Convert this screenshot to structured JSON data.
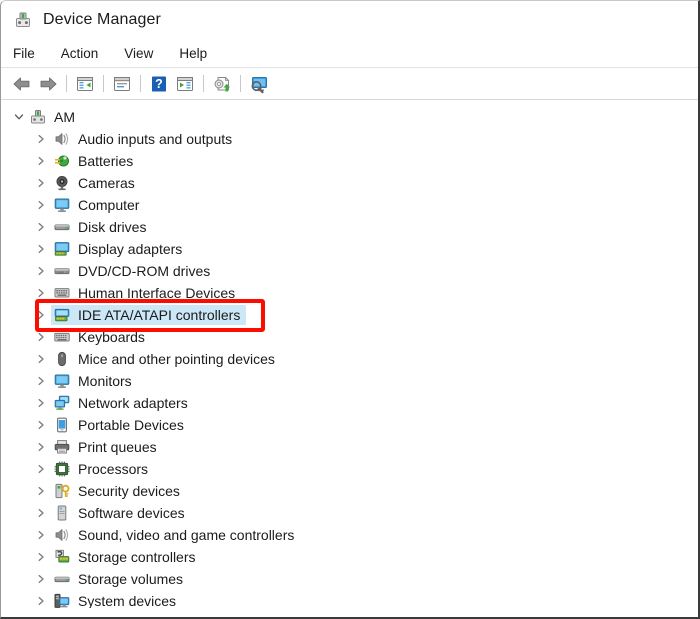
{
  "window": {
    "title": "Device Manager",
    "title_icon": "device-manager-icon"
  },
  "menubar": {
    "items": [
      {
        "label": "File",
        "name": "menu-file"
      },
      {
        "label": "Action",
        "name": "menu-action"
      },
      {
        "label": "View",
        "name": "menu-view"
      },
      {
        "label": "Help",
        "name": "menu-help"
      }
    ]
  },
  "toolbar": {
    "buttons": [
      {
        "name": "back-arrow-icon",
        "title": "Back"
      },
      {
        "name": "forward-arrow-icon",
        "title": "Forward"
      },
      {
        "name": "divider-1",
        "title": ""
      },
      {
        "name": "show-hide-console-tree-icon",
        "title": "Show/Hide Console Tree"
      },
      {
        "name": "properties-icon",
        "title": "Properties"
      },
      {
        "name": "divider-2",
        "title": ""
      },
      {
        "name": "help-icon",
        "title": "Help"
      },
      {
        "name": "scan-for-hardware-changes-icon",
        "title": "Scan for hardware changes"
      },
      {
        "name": "divider-3",
        "title": ""
      },
      {
        "name": "update-driver-icon",
        "title": "Update driver"
      },
      {
        "name": "divider-4",
        "title": ""
      },
      {
        "name": "display-devices-icon",
        "title": "Display devices"
      }
    ]
  },
  "tree": {
    "root": {
      "label": "AM",
      "expanded": true,
      "icon": "computer-root-icon"
    },
    "items": [
      {
        "label": "Audio inputs and outputs",
        "icon": "speaker-icon",
        "selected": false
      },
      {
        "label": "Batteries",
        "icon": "battery-icon",
        "selected": false
      },
      {
        "label": "Cameras",
        "icon": "camera-icon",
        "selected": false
      },
      {
        "label": "Computer",
        "icon": "monitor-icon",
        "selected": false
      },
      {
        "label": "Disk drives",
        "icon": "disk-drive-icon",
        "selected": false
      },
      {
        "label": "Display adapters",
        "icon": "display-adapter-icon",
        "selected": false
      },
      {
        "label": "DVD/CD-ROM drives",
        "icon": "dvd-drive-icon",
        "selected": false
      },
      {
        "label": "Human Interface Devices",
        "icon": "hid-icon",
        "selected": false
      },
      {
        "label": "IDE ATA/ATAPI controllers",
        "icon": "ide-controller-icon",
        "selected": true
      },
      {
        "label": "Keyboards",
        "icon": "keyboard-icon",
        "selected": false
      },
      {
        "label": "Mice and other pointing devices",
        "icon": "mouse-icon",
        "selected": false
      },
      {
        "label": "Monitors",
        "icon": "monitor-icon",
        "selected": false
      },
      {
        "label": "Network adapters",
        "icon": "network-adapter-icon",
        "selected": false
      },
      {
        "label": "Portable Devices",
        "icon": "portable-device-icon",
        "selected": false
      },
      {
        "label": "Print queues",
        "icon": "printer-icon",
        "selected": false
      },
      {
        "label": "Processors",
        "icon": "processor-icon",
        "selected": false
      },
      {
        "label": "Security devices",
        "icon": "security-device-icon",
        "selected": false
      },
      {
        "label": "Software devices",
        "icon": "software-device-icon",
        "selected": false
      },
      {
        "label": "Sound, video and game controllers",
        "icon": "speaker-icon",
        "selected": false
      },
      {
        "label": "Storage controllers",
        "icon": "storage-controller-icon",
        "selected": false
      },
      {
        "label": "Storage volumes",
        "icon": "storage-volume-icon",
        "selected": false
      },
      {
        "label": "System devices",
        "icon": "system-device-icon",
        "selected": false
      }
    ]
  },
  "annotation": {
    "type": "red-highlight-box",
    "target_label": "IDE ATA/ATAPI controllers",
    "color": "#fb0d00"
  },
  "colors": {
    "selection": "#cce8f7",
    "annotation": "#fb0d00",
    "text": "#1b1b1b"
  }
}
